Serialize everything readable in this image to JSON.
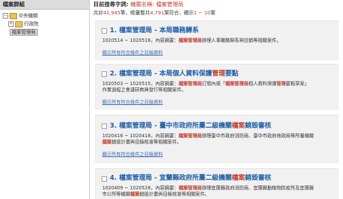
{
  "sidebar": {
    "title": "檔案群組",
    "tree": [
      {
        "label": "中央機關",
        "toggle": "−"
      },
      {
        "label": "行政院",
        "toggle": "+"
      },
      {
        "label": "檔案管理局"
      }
    ]
  },
  "search": {
    "label": "目前搜尋字詞:",
    "field_label": "機關名稱:",
    "keyword": "檔案管理局",
    "summary_prefix": "共計",
    "total_count": "41,945",
    "summary_mid": "筆，經彙整共",
    "matched_count": "4,791",
    "summary_mid2": "案符合，顯示",
    "range": "1 ~ 10",
    "summary_suffix": "案"
  },
  "results": [
    {
      "number": "1.",
      "agency": "檔案管理局",
      "sep": " - ",
      "title": "本局職務歸系",
      "title_parts": [
        {
          "t": "本局職務歸系",
          "h": false
        }
      ],
      "meta_line1_parts": [
        {
          "t": "1020514 ~ 1020516，內容摘要：",
          "h": false
        },
        {
          "t": "檔案管理局",
          "h": true
        },
        {
          "t": "辦理人事職務歸系與註銷等相關案件。",
          "h": false
        }
      ],
      "meta_line2_parts": [],
      "related": "顯示所有符合條件之目錄資料"
    },
    {
      "number": "2.",
      "agency": "檔案管理局",
      "sep": " - ",
      "title": "本局個人資料保護管理要點",
      "title_parts": [
        {
          "t": "本局個人資料保護",
          "h": false
        },
        {
          "t": "管理",
          "h": true
        },
        {
          "t": "要點",
          "h": false
        }
      ],
      "meta_line1_parts": [
        {
          "t": "1020503 ~ 1020515，內容摘要：",
          "h": false
        },
        {
          "t": "檔案管理局",
          "h": true
        },
        {
          "t": "訂頒內規「",
          "h": false
        },
        {
          "t": "檔案管理局",
          "h": true
        },
        {
          "t": "個人資料保護",
          "h": false
        },
        {
          "t": "管理",
          "h": true
        },
        {
          "t": "要點草案」",
          "h": false
        }
      ],
      "meta_line2_parts": [
        {
          "t": "作業過程之會議研商與發行等相關案件。",
          "h": false
        }
      ],
      "related": "顯示所有符合條件之目錄資料"
    },
    {
      "number": "3.",
      "agency": "檔案管理局",
      "sep": " - ",
      "title": "臺中市政府所屬二級機關檔案銷毀審核",
      "title_parts": [
        {
          "t": "臺中市政府所屬二級機關",
          "h": false
        },
        {
          "t": "檔案",
          "h": true
        },
        {
          "t": "銷毀審核",
          "h": false
        }
      ],
      "meta_line1_parts": [
        {
          "t": "1020416 ~ 1020418，內容摘要：",
          "h": false
        },
        {
          "t": "檔案管理局",
          "h": true
        },
        {
          "t": "辦理臺中市政府消防局、臺中市政府地政局等所屬機關",
          "h": false
        }
      ],
      "meta_line2_parts": [
        {
          "t": "檔案",
          "h": true
        },
        {
          "t": "銷毀計畫與目錄核准等相關案件。",
          "h": false
        }
      ],
      "related": "顯示所有符合條件之目錄資料"
    },
    {
      "number": "4.",
      "agency": "檔案管理局",
      "sep": " - ",
      "title": "宜蘭縣政府所屬二級機關檔案銷毀審核",
      "title_parts": [
        {
          "t": "宜蘭縣政府所屬二級機關",
          "h": false
        },
        {
          "t": "檔案",
          "h": true
        },
        {
          "t": "銷毀審核",
          "h": false
        }
      ],
      "meta_line1_parts": [
        {
          "t": "1020409 ~ 1020528，內容摘要：",
          "h": false
        },
        {
          "t": "檔案管理局",
          "h": true
        },
        {
          "t": "辦理宜蘭縣政府消防局、宜蘭縣動植物防疫所及宜蘭縣",
          "h": false
        }
      ],
      "meta_line2_parts": [
        {
          "t": "市公所等機關",
          "h": false
        },
        {
          "t": "檔案",
          "h": true
        },
        {
          "t": "銷毀計畫與目錄核准等相關案件。",
          "h": false
        }
      ],
      "related": ""
    }
  ],
  "colors": {
    "link": "#1f5fa8",
    "highlight": "#c0392b",
    "card_bg": "#f1f1f1"
  }
}
